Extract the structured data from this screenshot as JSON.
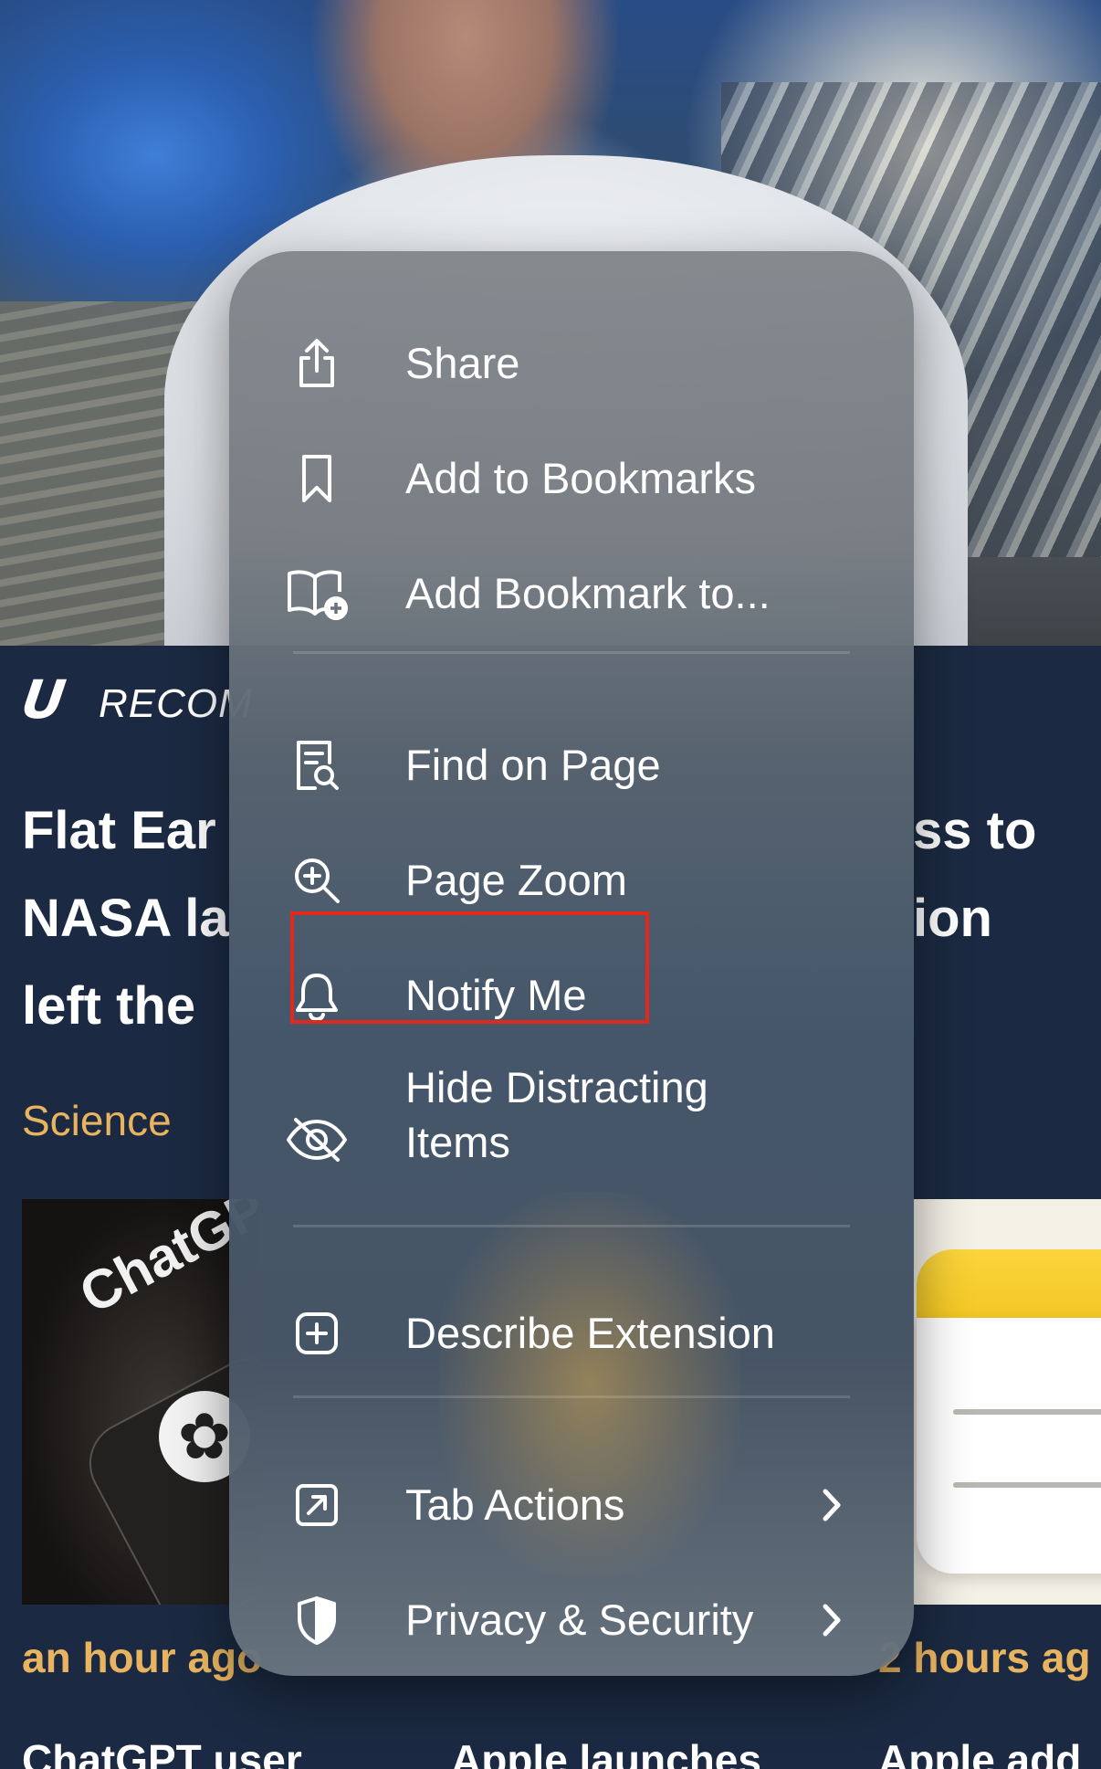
{
  "background": {
    "section_tag": "RECOM",
    "headline_left": [
      "Flat Ear",
      "NASA la",
      "left the"
    ],
    "headline_right": [
      "ss to",
      "ion"
    ],
    "category": "Science",
    "thumbnail_left_text": "ChatGP",
    "time_left": "an hour ago",
    "time_right": "2 hours ag",
    "stories": [
      "ChatGPT user",
      "Apple launches",
      "Apple add"
    ]
  },
  "menu": {
    "items": [
      {
        "label": "Share",
        "icon": "share-icon"
      },
      {
        "label": "Add to Bookmarks",
        "icon": "bookmark-icon"
      },
      {
        "label": "Add Bookmark to...",
        "icon": "book-add-icon"
      },
      {
        "label": "Find on Page",
        "icon": "find-on-page-icon"
      },
      {
        "label": "Page Zoom",
        "icon": "zoom-icon"
      },
      {
        "label": "Notify Me",
        "icon": "bell-icon"
      },
      {
        "label": "Hide Distracting Items",
        "icon": "eye-slash-icon"
      },
      {
        "label": "Describe Extension",
        "icon": "plus-square-icon"
      },
      {
        "label": "Tab Actions",
        "icon": "tab-arrow-icon",
        "submenu": true
      },
      {
        "label": "Privacy & Security",
        "icon": "shield-icon",
        "submenu": true
      }
    ],
    "highlighted_item": "Notify Me",
    "highlight_color": "#e0281c"
  },
  "colors": {
    "accent_gold": "#e9b460",
    "menu_text": "#ffffff"
  }
}
